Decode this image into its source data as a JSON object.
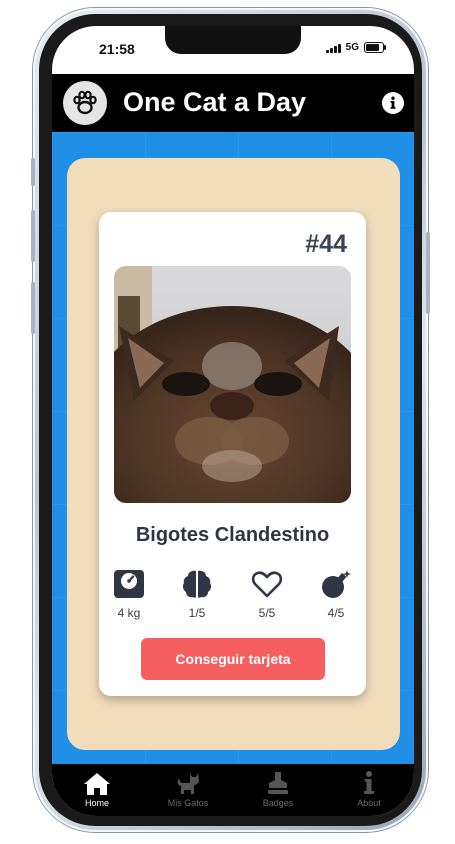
{
  "status_bar": {
    "time": "21:58",
    "network": "5G"
  },
  "header": {
    "title": "One Cat a Day",
    "logo_icon": "paw-icon",
    "info_icon": "info-icon"
  },
  "card": {
    "number": "#44",
    "cat_name": "Bigotes Clandestino",
    "stats": [
      {
        "icon": "weight-scale-icon",
        "value": "4 kg"
      },
      {
        "icon": "brain-icon",
        "value": "1/5"
      },
      {
        "icon": "heart-icon",
        "value": "5/5"
      },
      {
        "icon": "bomb-icon",
        "value": "4/5"
      }
    ],
    "button_label": "Conseguir tarjeta"
  },
  "bottom_nav": [
    {
      "label": "Home",
      "icon": "home-icon",
      "active": true
    },
    {
      "label": "Mis Gatos",
      "icon": "cat-icon",
      "active": false
    },
    {
      "label": "Badges",
      "icon": "stamp-icon",
      "active": false
    },
    {
      "label": "About",
      "icon": "info-letter-icon",
      "active": false
    }
  ],
  "colors": {
    "background_blue": "#1f8fe8",
    "panel_beige": "#f1dcbc",
    "button_red": "#f55f5f",
    "header_black": "#000000"
  }
}
